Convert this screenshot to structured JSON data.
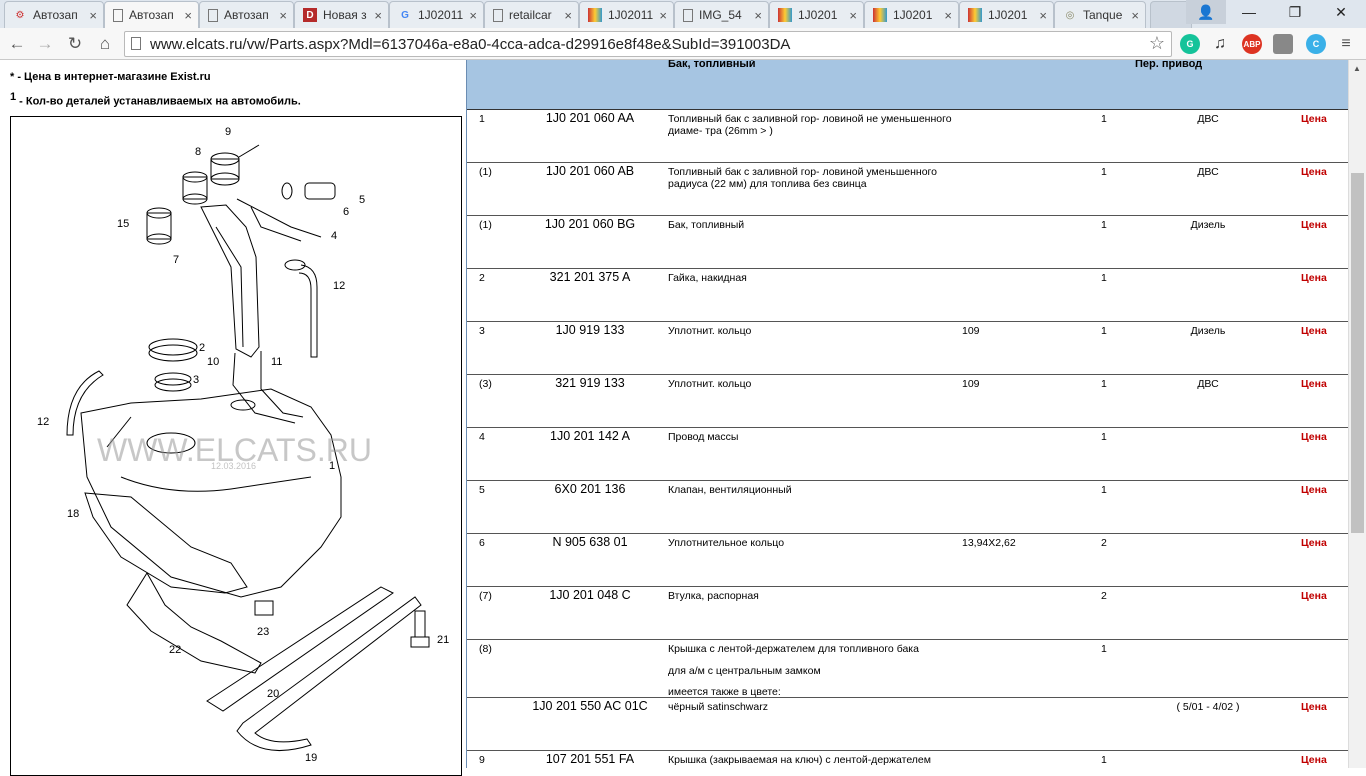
{
  "tabs": [
    {
      "title": "Автозап",
      "active": false
    },
    {
      "title": "Автозап",
      "active": true
    },
    {
      "title": "Автозап",
      "active": false
    },
    {
      "title": "Новая з",
      "active": false
    },
    {
      "title": "1J02011",
      "active": false
    },
    {
      "title": "retailcar",
      "active": false
    },
    {
      "title": "1J02011",
      "active": false
    },
    {
      "title": "IMG_54",
      "active": false
    },
    {
      "title": "1J0201",
      "active": false
    },
    {
      "title": "1J0201",
      "active": false
    },
    {
      "title": "1J0201",
      "active": false
    },
    {
      "title": "Tanque",
      "active": false
    }
  ],
  "address": {
    "url": "www.elcats.ru/vw/Parts.aspx?Mdl=6137046a-e8a0-4cca-adca-d29916e8f48e&SubId=391003DA"
  },
  "extensions": {
    "abp": "ABP"
  },
  "notes": {
    "star_mark": "*",
    "star_text": " - Цена в интернет-магазине Exist.ru",
    "qty_mark": "1",
    "qty_text": " - Кол-во деталей устанавливаемых на автомобиль."
  },
  "diagram": {
    "watermark": "WWW.ELCATS.RU",
    "watermark_sub": "12.03.2016",
    "callouts": [
      "1",
      "2",
      "3",
      "4",
      "5",
      "6",
      "7",
      "8",
      "9",
      "10",
      "11",
      "12",
      "12",
      "15",
      "18",
      "19",
      "20",
      "21",
      "22",
      "23"
    ]
  },
  "table": {
    "header_name": "Бак, топливный",
    "header_drive": "Пер. привод",
    "rows": [
      {
        "pos": "1",
        "number": "1J0 201 060 AA",
        "name": "Топливный бак с заливной гор- ловиной не уменьшенного диаме- тра (26mm > )",
        "extra": "",
        "qty": "1",
        "drive": "ДВС",
        "price": "Цена"
      },
      {
        "pos": "(1)",
        "number": "1J0 201 060 AB",
        "name": "Топливный бак с заливной гор- ловиной уменьшенного радиуса (22 мм) для топлива без свинца",
        "extra": "",
        "qty": "1",
        "drive": "ДВС",
        "price": "Цена"
      },
      {
        "pos": "(1)",
        "number": "1J0 201 060 BG",
        "name": "Бак, топливный",
        "extra": "",
        "qty": "1",
        "drive": "Дизель",
        "price": "Цена"
      },
      {
        "pos": "2",
        "number": "321 201 375 A",
        "name": "Гайка, накидная",
        "extra": "",
        "qty": "1",
        "drive": "",
        "price": "Цена"
      },
      {
        "pos": "3",
        "number": "1J0 919 133",
        "name": "Уплотнит. кольцо",
        "extra": "109",
        "qty": "1",
        "drive": "Дизель",
        "price": "Цена"
      },
      {
        "pos": "(3)",
        "number": "321 919 133",
        "name": "Уплотнит. кольцо",
        "extra": "109",
        "qty": "1",
        "drive": "ДВС",
        "price": "Цена"
      },
      {
        "pos": "4",
        "number": "1J0 201 142 A",
        "name": "Провод массы",
        "extra": "",
        "qty": "1",
        "drive": "",
        "price": "Цена"
      },
      {
        "pos": "5",
        "number": "6X0 201 136",
        "name": "Клапан, вентиляционный",
        "extra": "",
        "qty": "1",
        "drive": "",
        "price": "Цена"
      },
      {
        "pos": "6",
        "number": "N 905 638 01",
        "name": "Уплотнительное кольцо",
        "extra": "13,94X2,62",
        "qty": "2",
        "drive": "",
        "price": "Цена"
      },
      {
        "pos": "(7)",
        "number": "1J0 201 048 C",
        "name": "Втулка, распорная",
        "extra": "",
        "qty": "2",
        "drive": "",
        "price": "Цена"
      }
    ],
    "row8": {
      "pos": "(8)",
      "line1": "Крышка с лентой-держателем для топливного бака",
      "line2": "для а/м с центральным замком",
      "line3": "имеется также в цвете:",
      "qty": "1"
    },
    "row8b": {
      "number": "1J0 201 550 AC 01C",
      "name": "чёрный satinschwarz",
      "drive": "( 5/01 - 4/02 )",
      "price": "Цена"
    },
    "row9": {
      "pos": "9",
      "number": "107 201 551 FA",
      "name": "Крышка (закрываемая на ключ) с лентой-держателем",
      "qty": "1",
      "price": "Цена"
    }
  }
}
